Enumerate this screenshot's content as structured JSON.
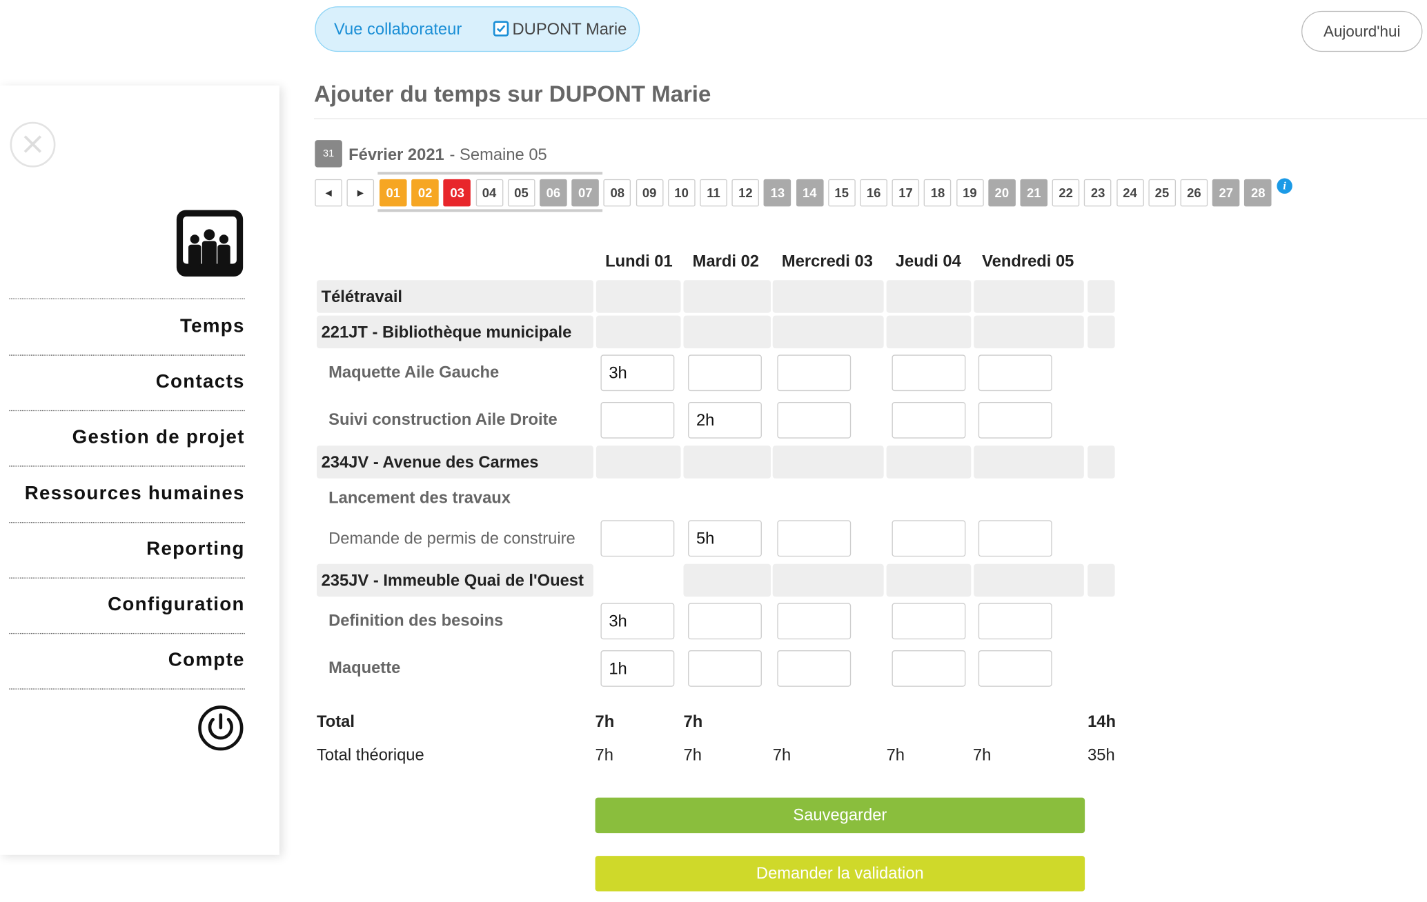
{
  "header": {
    "toggle_view_label": "Vue collaborateur",
    "toggle_user_label": "DUPONT Marie",
    "today_label": "Aujourd'hui"
  },
  "sidebar": {
    "close_glyph": "×",
    "items": [
      {
        "label": "Temps"
      },
      {
        "label": "Contacts"
      },
      {
        "label": "Gestion de projet"
      },
      {
        "label": "Ressources humaines"
      },
      {
        "label": "Reporting"
      },
      {
        "label": "Configuration"
      },
      {
        "label": "Compte"
      }
    ]
  },
  "page": {
    "title": "Ajouter du temps sur DUPONT Marie",
    "calendar_icon_text": "31",
    "month": "Février 2021",
    "week": "- Semaine 05"
  },
  "days": {
    "prev_glyph": "◀",
    "next_glyph": "▶",
    "list": [
      "01",
      "02",
      "03",
      "04",
      "05",
      "06",
      "07",
      "08",
      "09",
      "10",
      "11",
      "12",
      "13",
      "14",
      "15",
      "16",
      "17",
      "18",
      "19",
      "20",
      "21",
      "22",
      "23",
      "24",
      "25",
      "26",
      "27",
      "28"
    ],
    "styles": [
      "orange",
      "orange",
      "red",
      "",
      "",
      "we",
      "we",
      "",
      "",
      "",
      "",
      "",
      "we",
      "we",
      "",
      "",
      "",
      "",
      "",
      "we",
      "we",
      "",
      "",
      "",
      "",
      "",
      "we",
      "we"
    ],
    "info_glyph": "i"
  },
  "grid": {
    "day_headers": [
      "Lundi 01",
      "Mardi 02",
      "Mercredi 03",
      "Jeudi 04",
      "Vendredi 05"
    ],
    "groups": [
      {
        "label": "Télétravail"
      },
      {
        "label": "221JT - Bibliothèque municipale"
      },
      {
        "label": "234JV - Avenue des Carmes"
      },
      {
        "label": "235JV - Immeuble Quai de l'Ouest"
      }
    ],
    "tasks": [
      {
        "label": "Maquette Aile Gauche",
        "values": [
          "3h",
          "",
          "",
          "",
          ""
        ]
      },
      {
        "label": "Suivi construction Aile Droite",
        "values": [
          "",
          "2h",
          "",
          "",
          ""
        ]
      },
      {
        "label": "Lancement des travaux",
        "values": []
      },
      {
        "label": "Demande de permis de construire",
        "values": [
          "",
          "5h",
          "",
          "",
          ""
        ]
      },
      {
        "label": "Definition des besoins",
        "values": [
          "3h",
          "",
          "",
          "",
          ""
        ]
      },
      {
        "label": "Maquette",
        "values": [
          "1h",
          "",
          "",
          "",
          ""
        ]
      }
    ]
  },
  "totals": {
    "total_label": "Total",
    "total_values": [
      "7h",
      "7h"
    ],
    "total_sum": "14h",
    "theorique_label": "Total théorique",
    "theorique_values": [
      "7h",
      "7h",
      "7h",
      "7h",
      "7h"
    ],
    "theorique_sum": "35h"
  },
  "actions": {
    "save_label": "Sauvegarder",
    "validate_label": "Demander la validation"
  },
  "colors": {
    "save_button": "#8abe3d",
    "validate_button": "#cfd92a",
    "accent_blue": "#1b8fd6",
    "today_orange": "#f6a623",
    "today_red": "#e8262b",
    "weekend_grey": "#aaaaaa"
  }
}
